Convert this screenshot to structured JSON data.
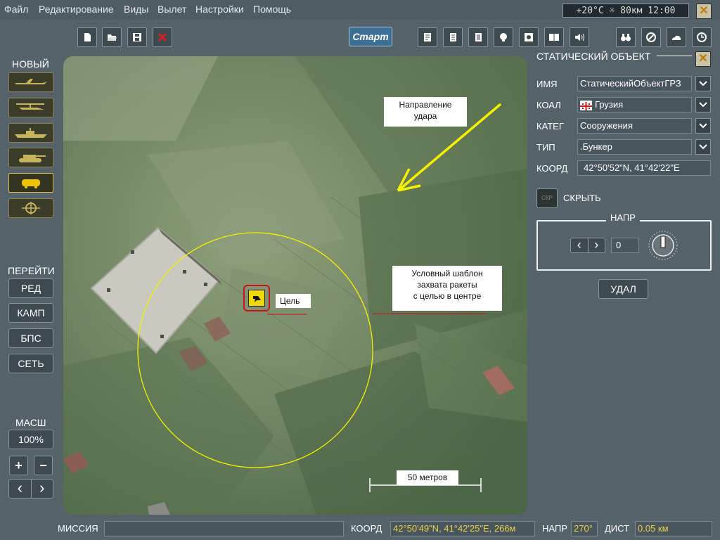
{
  "menu": {
    "items": [
      "Файл",
      "Редактирование",
      "Виды",
      "Вылет",
      "Настройки",
      "Помощь"
    ],
    "status": "+20°C ☼ 80км 12:00",
    "close_label": "✕"
  },
  "toolbar": {
    "start_label": "Старт",
    "left_icons": [
      "new-file-icon",
      "open-folder-icon",
      "save-icon",
      "delete-icon"
    ],
    "center_icons": [
      "mission-goals-icon",
      "briefing-icon",
      "checklist-icon",
      "face-icon",
      "preview-icon",
      "book-icon",
      "sound-icon"
    ],
    "right_icons": [
      "binoculars-icon",
      "forbidden-icon",
      "weather-icon",
      "clock-icon"
    ]
  },
  "left_panel": {
    "new_label": "НОВЫЙ",
    "new_buttons": [
      "aircraft-icon",
      "helicopter-icon",
      "ship-icon",
      "tank-icon",
      "static-object-icon",
      "target-zone-icon"
    ],
    "goto_label": "ПЕРЕЙТИ",
    "goto_buttons": [
      "РЕД",
      "КАМП",
      "БПС",
      "СЕТЬ"
    ],
    "scale_label": "МАСШ",
    "scale_value": "100%",
    "zoom_in": "+",
    "zoom_out": "−",
    "prev": "‹",
    "next": "›"
  },
  "map": {
    "direction_note": "Направление\nудара",
    "template_note": "Условный шаблон\nзахвата ракеты\nс целью в центре",
    "target_label": "Цель",
    "scale_bar_label": "50 метров"
  },
  "object_panel": {
    "title": "СТАТИЧЕСКИЙ ОБЪЕКТ",
    "close_label": "✕",
    "name_label": "ИМЯ",
    "name_value": "СтатическийОбъектГРЗ",
    "coal_label": "КОАЛ",
    "coal_value": "Грузия",
    "cat_label": "КАТЕГ",
    "cat_value": "Сооружения",
    "type_label": "ТИП",
    "type_value": ".Бункер",
    "coord_label": "КООРД",
    "coord_value": "42°50'52\"N, 41°42'22\"E",
    "hide_btn": "СКР",
    "hide_label": "СКРЫТЬ",
    "heading_title": "НАПР",
    "heading_value": "0",
    "delete_label": "УДАЛ"
  },
  "status_bar": {
    "mission_label": "МИССИЯ",
    "mission_value": "",
    "coord_label": "КООРД",
    "coord_value": "42°50'49\"N, 41°42'25\"E, 266м",
    "heading_label": "НАПР",
    "heading_value": "270°",
    "dist_label": "ДИСТ",
    "dist_value": "0.05 км"
  },
  "colors": {
    "background": "#55626a",
    "field": "#4a565d",
    "status_value": "#e8d046",
    "start_button": "#3c6f96",
    "close_x": "#c07b00",
    "circle": "#f2f000",
    "target_highlight": "#c8141e"
  }
}
